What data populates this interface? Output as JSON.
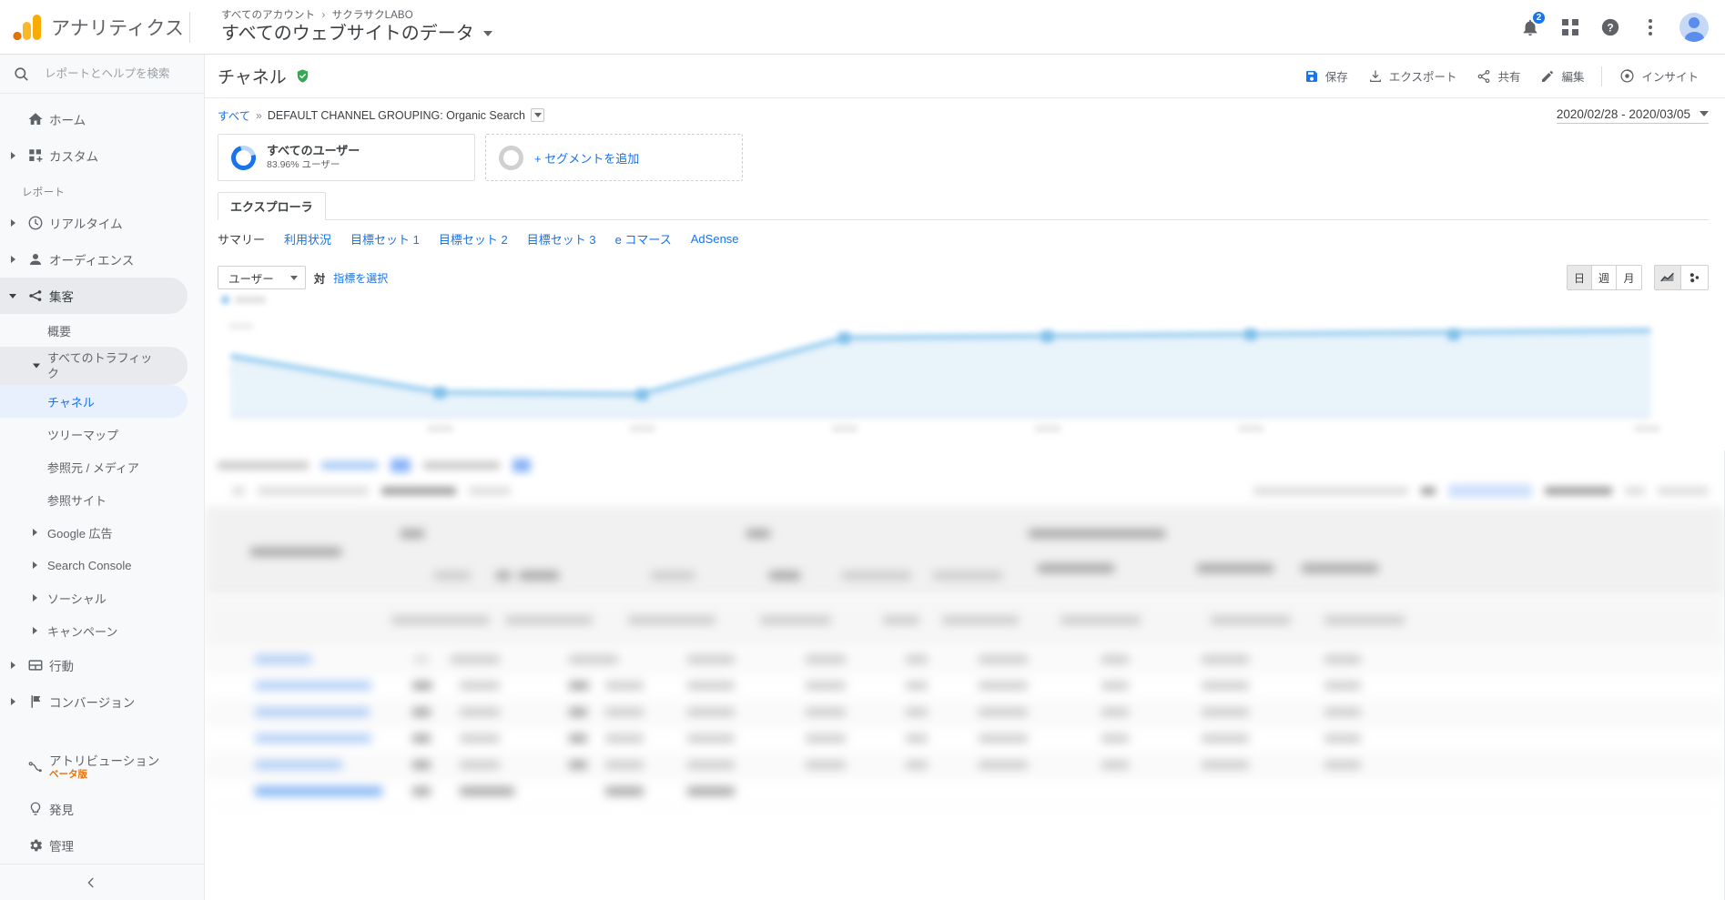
{
  "topbar": {
    "brand_name": "アナリティクス",
    "breadcrumb_account": "すべてのアカウント",
    "breadcrumb_sep": "›",
    "breadcrumb_property": "サクラサクLABO",
    "property_title": "すべてのウェブサイトのデータ",
    "notifications_count": "2",
    "icons": {
      "bell": "bell-icon",
      "apps": "apps-grid-icon",
      "help": "help-icon",
      "more": "more-vert-icon",
      "avatar": "account-avatar"
    }
  },
  "sidebar": {
    "search_placeholder": "レポートとヘルプを検索",
    "section_label": "レポート",
    "top_items": [
      {
        "label": "ホーム",
        "icon": "home-icon",
        "expandable": false
      },
      {
        "label": "カスタム",
        "icon": "custom-grid-icon",
        "expandable": true
      }
    ],
    "report_items": [
      {
        "label": "リアルタイム",
        "icon": "clock-icon",
        "expandable": true,
        "active": false
      },
      {
        "label": "オーディエンス",
        "icon": "person-icon",
        "expandable": true,
        "active": false
      },
      {
        "label": "集客",
        "icon": "acquisition-icon",
        "expandable": true,
        "active": true
      }
    ],
    "acquisition_children": [
      {
        "label": "概要",
        "style": "plain"
      },
      {
        "label": "すべてのトラフィック",
        "style": "grey",
        "expandable": true
      },
      {
        "label": "チャネル",
        "style": "selected"
      },
      {
        "label": "ツリーマップ",
        "style": "plain"
      },
      {
        "label": "参照元 / メディア",
        "style": "plain"
      },
      {
        "label": "参照サイト",
        "style": "plain"
      },
      {
        "label": "Google 広告",
        "style": "plain",
        "expandable": true
      },
      {
        "label": "Search Console",
        "style": "plain",
        "expandable": true
      },
      {
        "label": "ソーシャル",
        "style": "plain",
        "expandable": true
      },
      {
        "label": "キャンペーン",
        "style": "plain",
        "expandable": true
      }
    ],
    "tail_items": [
      {
        "label": "行動",
        "icon": "behavior-icon",
        "expandable": true
      },
      {
        "label": "コンバージョン",
        "icon": "flag-icon",
        "expandable": true
      }
    ],
    "bottom_items": [
      {
        "label": "アトリビューション",
        "icon": "attribution-icon",
        "badge": "ベータ版"
      },
      {
        "label": "発見",
        "icon": "bulb-icon",
        "badge": ""
      },
      {
        "label": "管理",
        "icon": "gear-icon",
        "badge": ""
      }
    ],
    "collapse_icon": "chevron-left-icon"
  },
  "report": {
    "title": "チャネル",
    "verified_icon": "verified-shield-icon",
    "actions": [
      {
        "label": "保存",
        "icon": "save-icon"
      },
      {
        "label": "エクスポート",
        "icon": "export-icon"
      },
      {
        "label": "共有",
        "icon": "share-icon"
      },
      {
        "label": "編集",
        "icon": "edit-icon"
      },
      {
        "label": "インサイト",
        "icon": "insights-icon"
      }
    ],
    "breadcrumb": {
      "all": "すべて",
      "arrows": "»",
      "current": "DEFAULT CHANNEL GROUPING: Organic Search"
    },
    "date_range": "2020/02/28 - 2020/03/05"
  },
  "segments": [
    {
      "name": "すべてのユーザー",
      "sub": "83.96% ユーザー",
      "type": "filled"
    },
    {
      "name": "+ セグメントを追加",
      "sub": "",
      "type": "add"
    }
  ],
  "explorer": {
    "tab_label": "エクスプローラ",
    "subtabs": [
      {
        "label": "サマリー",
        "active": true
      },
      {
        "label": "利用状況",
        "active": false
      },
      {
        "label": "目標セット 1",
        "active": false
      },
      {
        "label": "目標セット 2",
        "active": false
      },
      {
        "label": "目標セット 3",
        "active": false
      },
      {
        "label": "e コマース",
        "active": false
      },
      {
        "label": "AdSense",
        "active": false
      }
    ]
  },
  "chart_controls": {
    "metric_label": "ユーザー",
    "vs_label": "対",
    "pick_metric": "指標を選択",
    "granularity": [
      {
        "label": "日",
        "active": true
      },
      {
        "label": "週",
        "active": false
      },
      {
        "label": "月",
        "active": false
      }
    ],
    "view_types": [
      {
        "icon": "line-chart-icon",
        "active": true
      },
      {
        "icon": "motion-chart-icon",
        "active": false
      }
    ]
  },
  "chart_data": {
    "type": "area",
    "title": "",
    "xlabel": "",
    "ylabel": "ユーザー",
    "grid": false,
    "legend": "ユーザー",
    "categories": [
      "",
      "",
      "",
      "",
      "",
      "",
      ""
    ],
    "series": [
      {
        "name": "ユーザー",
        "values": [
          62,
          32,
          31,
          72,
          74,
          75,
          77
        ]
      }
    ],
    "ylim": [
      0,
      100
    ],
    "note": "chart rendering is blurred/redacted in the source screenshot"
  },
  "table": {
    "redacted": true,
    "note": "table contents are blurred in the source screenshot",
    "row_count": 6
  },
  "colors": {
    "accent_blue": "#1a73e8",
    "chart_line": "#7cc0ec",
    "chart_fill": "#e4f1fa",
    "sidebar_bg": "#f8f9fa",
    "selected_bg": "#e8f0fe",
    "beta_orange": "#e8710a",
    "verified_green": "#34a853",
    "ga_orange": "#f9ab00"
  }
}
